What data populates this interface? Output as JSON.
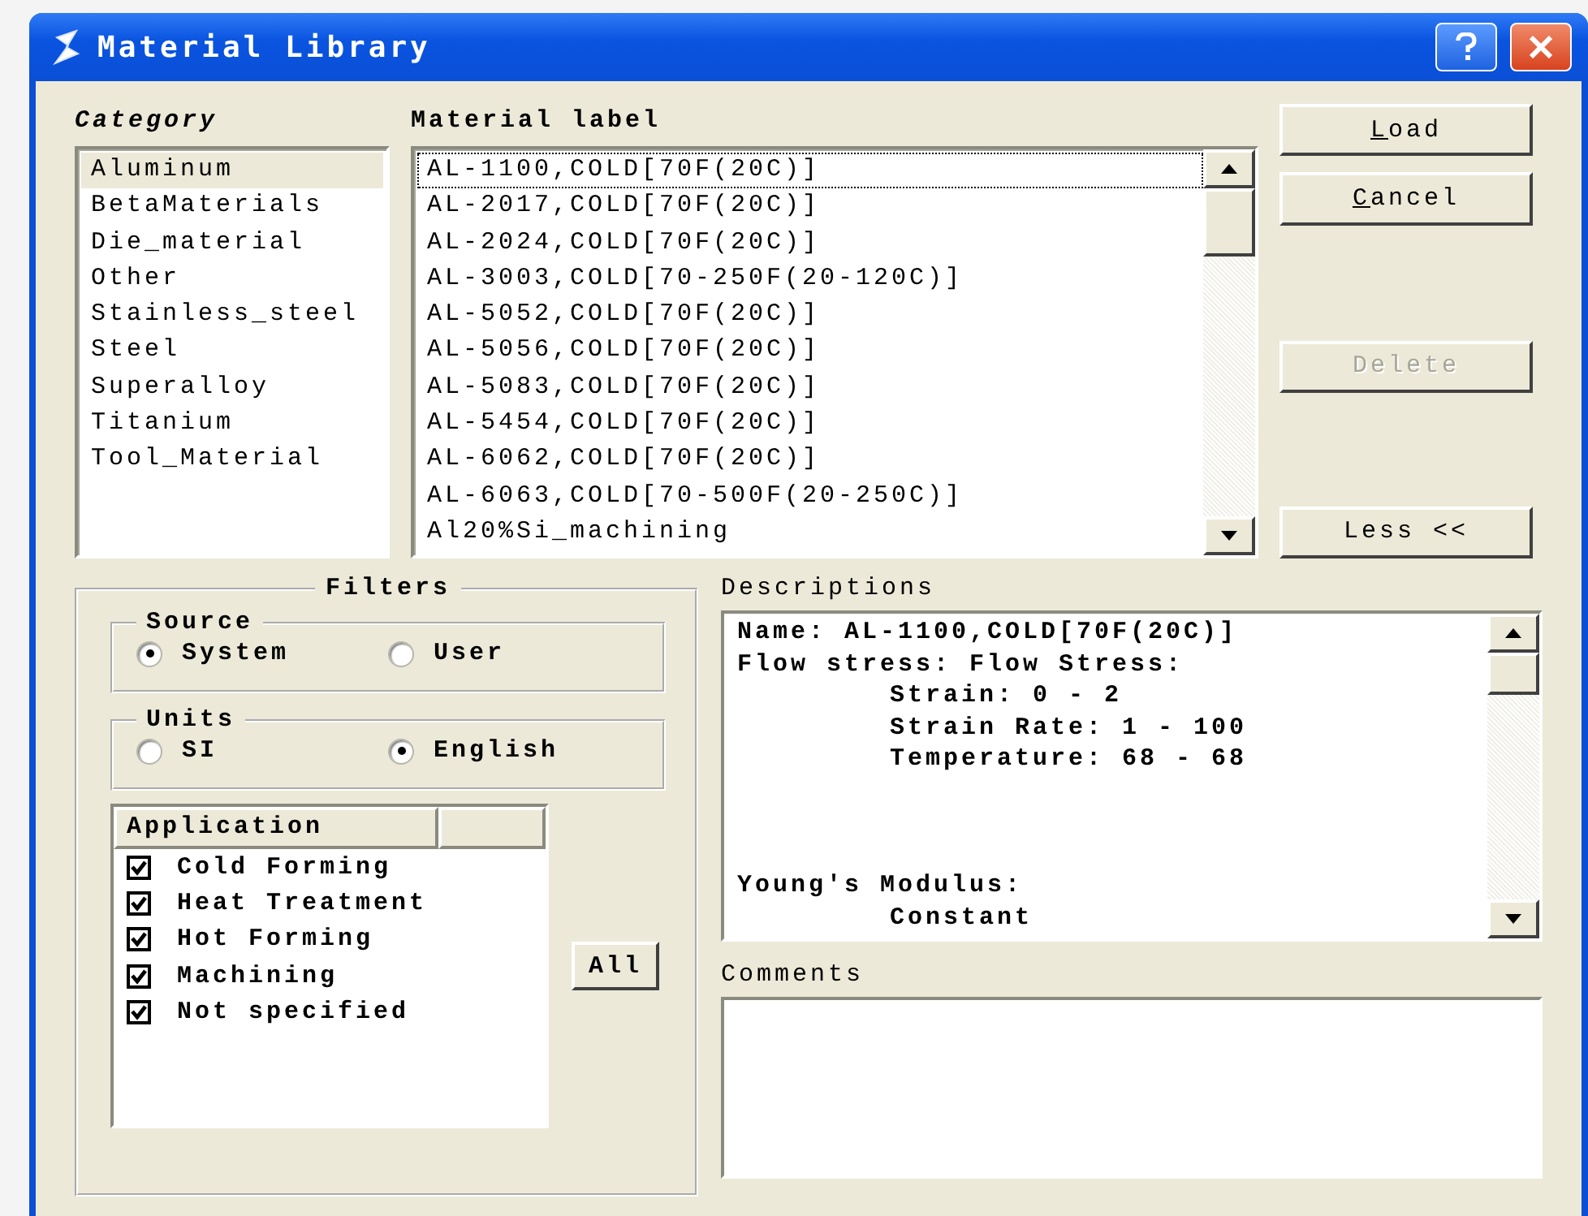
{
  "window": {
    "title": "Material Library"
  },
  "category": {
    "label": "Category",
    "items": [
      {
        "text": "Aluminum",
        "selected": true
      },
      {
        "text": "BetaMaterials",
        "selected": false
      },
      {
        "text": "Die_material",
        "selected": false
      },
      {
        "text": "Other",
        "selected": false
      },
      {
        "text": "Stainless_steel",
        "selected": false
      },
      {
        "text": "Steel",
        "selected": false
      },
      {
        "text": "Superalloy",
        "selected": false
      },
      {
        "text": "Titanium",
        "selected": false
      },
      {
        "text": "Tool_Material",
        "selected": false
      }
    ]
  },
  "material": {
    "label": "Material label",
    "items": [
      {
        "text": "AL-1100,COLD[70F(20C)]",
        "selected": true
      },
      {
        "text": "AL-2017,COLD[70F(20C)]",
        "selected": false
      },
      {
        "text": "AL-2024,COLD[70F(20C)]",
        "selected": false
      },
      {
        "text": "AL-3003,COLD[70-250F(20-120C)]",
        "selected": false
      },
      {
        "text": "AL-5052,COLD[70F(20C)]",
        "selected": false
      },
      {
        "text": "AL-5056,COLD[70F(20C)]",
        "selected": false
      },
      {
        "text": "AL-5083,COLD[70F(20C)]",
        "selected": false
      },
      {
        "text": "AL-5454,COLD[70F(20C)]",
        "selected": false
      },
      {
        "text": "AL-6062,COLD[70F(20C)]",
        "selected": false
      },
      {
        "text": "AL-6063,COLD[70-500F(20-250C)]",
        "selected": false
      },
      {
        "text": "Al20%Si_machining",
        "selected": false
      }
    ]
  },
  "buttons": [
    {
      "label": "Load",
      "mnemonic": true,
      "disabled": false
    },
    {
      "label": "Cancel",
      "mnemonic": true,
      "disabled": false
    },
    {
      "label": "Delete",
      "mnemonic": false,
      "disabled": true
    },
    {
      "label": "Less <<",
      "mnemonic": false,
      "disabled": false
    }
  ],
  "filters": {
    "title": "Filters",
    "source": {
      "title": "Source",
      "options": [
        {
          "label": "System",
          "selected": true
        },
        {
          "label": "User",
          "selected": false
        }
      ]
    },
    "units": {
      "title": "Units",
      "options": [
        {
          "label": "SI",
          "selected": false
        },
        {
          "label": "English",
          "selected": true
        }
      ]
    },
    "application": {
      "header": "Application",
      "items": [
        {
          "label": "Cold Forming",
          "checked": true
        },
        {
          "label": "Heat Treatment",
          "checked": true
        },
        {
          "label": "Hot Forming",
          "checked": true
        },
        {
          "label": "Machining",
          "checked": true
        },
        {
          "label": "Not specified",
          "checked": true
        }
      ]
    },
    "all_button": "All"
  },
  "descriptions": {
    "label": "Descriptions",
    "lines": [
      {
        "kind": "text",
        "text": "Name: AL-1100,COLD[70F(20C)]"
      },
      {
        "kind": "text",
        "text": "Flow stress: Flow Stress:"
      },
      {
        "kind": "indented",
        "text": "Strain: 0 - 2"
      },
      {
        "kind": "indented",
        "text": "Strain Rate: 1 - 100"
      },
      {
        "kind": "indented",
        "text": "Temperature: 68 - 68"
      },
      {
        "kind": "blank"
      },
      {
        "kind": "blank"
      },
      {
        "kind": "blank"
      },
      {
        "kind": "text",
        "text": "Young's Modulus:"
      },
      {
        "kind": "indented",
        "text": "Constant"
      }
    ]
  },
  "comments": {
    "label": "Comments"
  }
}
